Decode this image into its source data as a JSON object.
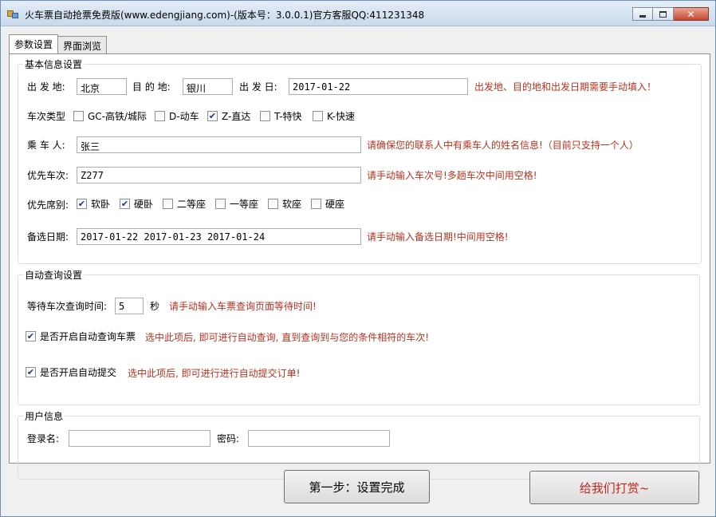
{
  "window": {
    "title": "火车票自动抢票免费版(www.edengjiang.com)-(版本号：3.0.0.1)官方客服QQ:411231348",
    "close_glyph": "✕"
  },
  "tabs": [
    "参数设置",
    "界面浏览"
  ],
  "basic": {
    "group_title": "基本信息设置",
    "from_label": "出 发 地:",
    "from_value": "北京",
    "to_label": "目 的 地:",
    "to_value": "银川",
    "date_label": "出 发 日:",
    "date_value": "2017-01-22",
    "required_hint": "出发地、目的地和出发日期需要手动填入！",
    "train_type_label": "车次类型",
    "train_types": [
      {
        "label": "GC-高铁/城际",
        "checked": false
      },
      {
        "label": "D-动车",
        "checked": false
      },
      {
        "label": "Z-直达",
        "checked": true
      },
      {
        "label": "T-特快",
        "checked": false
      },
      {
        "label": "K-快速",
        "checked": false
      }
    ],
    "passenger_label": "乘 车 人:",
    "passenger_value": "张三",
    "passenger_hint": "请确保您的联系人中有乘车人的姓名信息!（目前只支持一个人）",
    "priority_train_label": "优先车次:",
    "priority_train_value": "Z277",
    "priority_train_hint": "请手动输入车次号!多趟车次中间用空格!",
    "seat_label": "优先席别:",
    "seats": [
      {
        "label": "软卧",
        "checked": true
      },
      {
        "label": "硬卧",
        "checked": true
      },
      {
        "label": "二等座",
        "checked": false
      },
      {
        "label": "一等座",
        "checked": false
      },
      {
        "label": "软座",
        "checked": false
      },
      {
        "label": "硬座",
        "checked": false
      }
    ],
    "alt_dates_label": "备选日期:",
    "alt_dates_value": "2017-01-22 2017-01-23 2017-01-24",
    "alt_dates_hint": "请手动输入备选日期!中间用空格!"
  },
  "auto": {
    "group_title": "自动查询设置",
    "wait_label": "等待车次查询时间:",
    "wait_value": "5",
    "wait_unit": "秒",
    "wait_hint": "请手动输入车票查询页面等待时间!",
    "auto_query_label": "是否开启自动查询车票",
    "auto_query_checked": true,
    "auto_query_hint": "选中此项后, 即可进行自动查询, 直到查询到与您的条件相符的车次!",
    "auto_submit_label": "是否开启自动提交",
    "auto_submit_checked": true,
    "auto_submit_hint": "选中此项后, 即可进行进行自动提交订单!"
  },
  "user": {
    "group_title": "用户信息",
    "login_label": "登录名:",
    "login_value": "",
    "password_label": "密码:",
    "password_value": ""
  },
  "buttons": {
    "step1": "第一步：设置完成",
    "reward": "给我们打赏~"
  },
  "check_glyph": "✔",
  "colors": {
    "hint_red": "#b8321f",
    "reward_red": "#c0281e"
  }
}
